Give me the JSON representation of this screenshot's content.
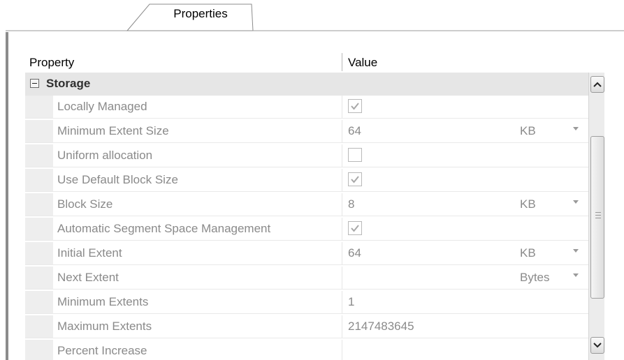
{
  "tabs": [
    {
      "label": "Properties",
      "active": true
    }
  ],
  "grid": {
    "columns": {
      "property": "Property",
      "value": "Value"
    },
    "category": {
      "label": "Storage",
      "expanded": true
    },
    "rows": [
      {
        "name": "Locally Managed",
        "type": "checkbox",
        "checked": true
      },
      {
        "name": "Minimum Extent Size",
        "type": "dropdown",
        "value": "64",
        "unit": "KB"
      },
      {
        "name": "Uniform allocation",
        "type": "checkbox",
        "checked": false
      },
      {
        "name": "Use Default Block Size",
        "type": "checkbox",
        "checked": true
      },
      {
        "name": "Block Size",
        "type": "dropdown",
        "value": "8",
        "unit": "KB"
      },
      {
        "name": "Automatic Segment Space Management",
        "type": "checkbox",
        "checked": true
      },
      {
        "name": "Initial Extent",
        "type": "dropdown",
        "value": "64",
        "unit": "KB"
      },
      {
        "name": "Next Extent",
        "type": "dropdown",
        "value": "",
        "unit": "Bytes"
      },
      {
        "name": "Minimum Extents",
        "type": "text",
        "value": "1"
      },
      {
        "name": "Maximum Extents",
        "type": "text",
        "value": "2147483645"
      },
      {
        "name": "Percent Increase",
        "type": "text",
        "value": ""
      }
    ]
  },
  "colors": {
    "disabled_text": "#8a8a8a",
    "category_bg": "#e6e6e6",
    "checkmark": "#a8a8a8"
  },
  "icons": {
    "collapse": "minus-box-icon",
    "scroll_up": "chevron-up-icon",
    "scroll_down": "chevron-down-icon",
    "check": "checkmark-icon",
    "dropdown": "triangle-down-icon"
  }
}
